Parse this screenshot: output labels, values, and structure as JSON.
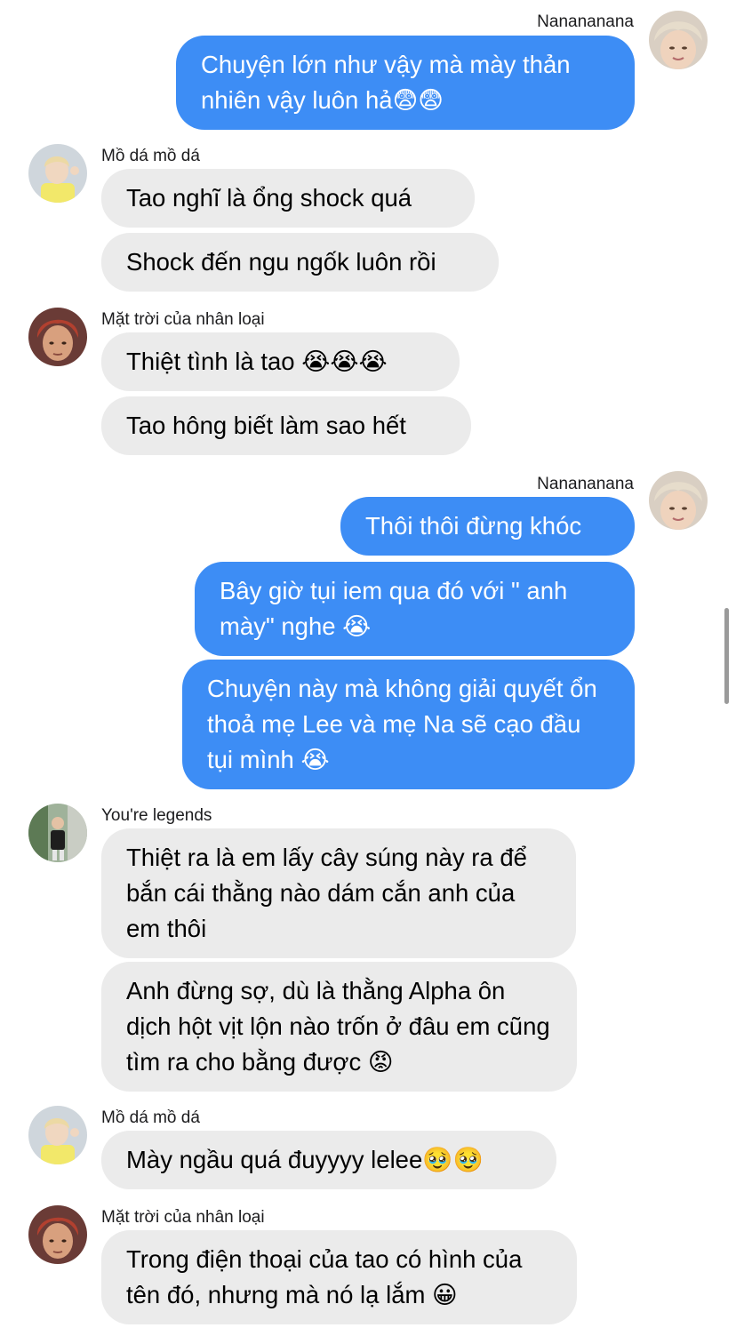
{
  "messages": [
    {
      "sender": "Nanananana",
      "text": "Chuyện lớn như vậy mà mày thản nhiên vậy luôn hả😨😨"
    },
    {
      "sender": "Mồ dá mồ dá",
      "text": "Tao nghĩ là ổng shock quá"
    },
    {
      "sender": "Mồ dá mồ dá",
      "text": "Shock đến ngu ngốk luôn rồi"
    },
    {
      "sender": "Mặt trời của nhân loại",
      "text": "Thiệt tình là tao 😭😭😭"
    },
    {
      "sender": "Mặt trời của nhân loại",
      "text": "Tao hông biết làm sao hết"
    },
    {
      "sender": "Nanananana",
      "text": "Thôi thôi đừng khóc"
    },
    {
      "sender": "Nanananana",
      "text": "Bây giờ tụi iem qua đó với \" anh mày\" nghe 😭"
    },
    {
      "sender": "Nanananana",
      "text": "Chuyện này mà không giải quyết ổn thoả mẹ Lee và mẹ Na sẽ cạo đầu tụi mình 😭"
    },
    {
      "sender": "You're legends",
      "text": "Thiệt ra là em lấy cây súng này ra để bắn cái thằng nào dám cắn anh của em thôi"
    },
    {
      "sender": "You're legends",
      "text": "Anh đừng sợ, dù là thằng Alpha ôn dịch hột vịt lộn nào trốn ở đâu em cũng tìm ra cho bằng được 😡"
    },
    {
      "sender": "Mồ dá mồ dá",
      "text": "Mày ngầu quá đuyyyy lelee🥹🥹"
    },
    {
      "sender": "Mặt trời của nhân loại",
      "text": "Trong điện thoại của tao có hình của tên đó, nhưng mà nó lạ lắm 😀"
    }
  ]
}
